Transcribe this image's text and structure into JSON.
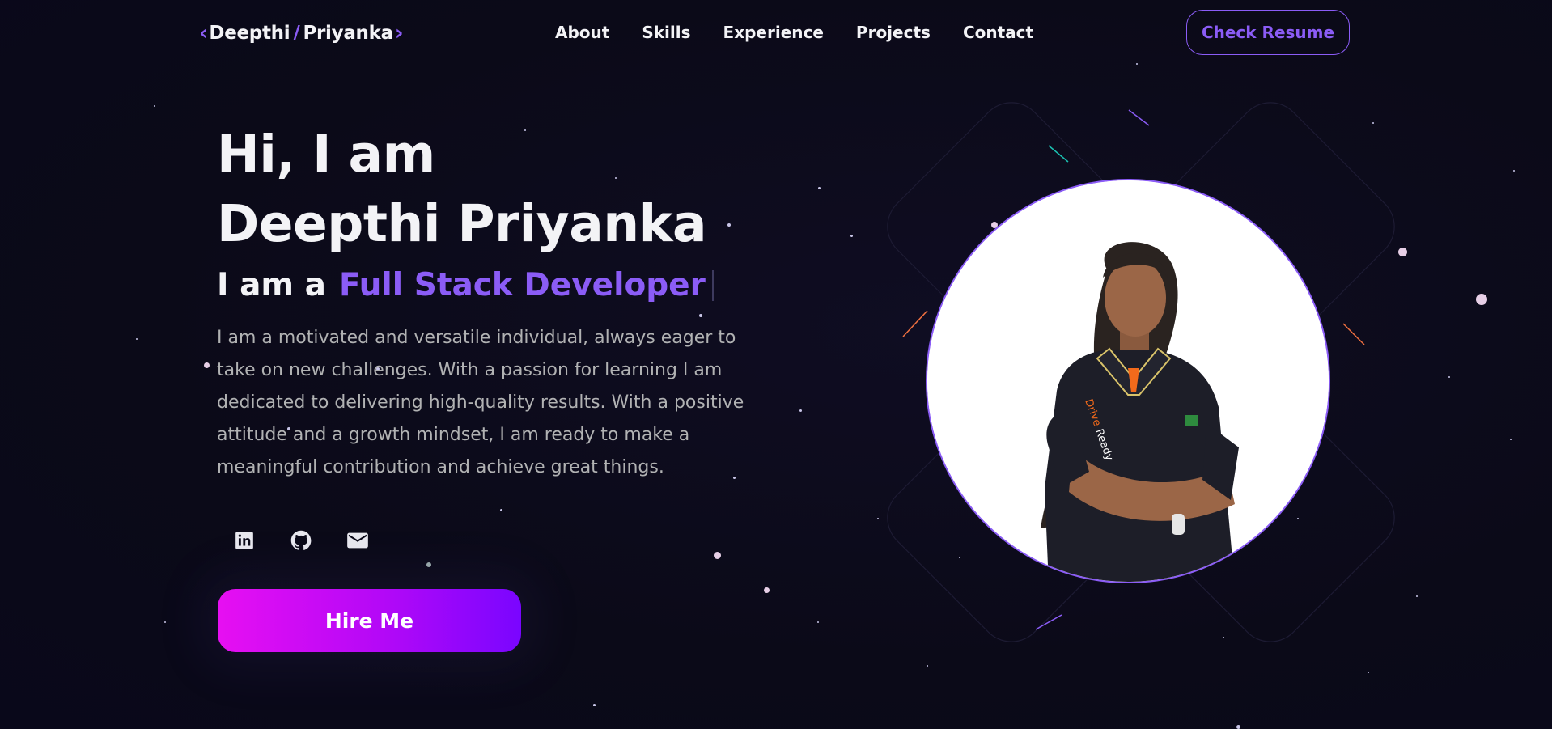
{
  "nav": {
    "logo": {
      "left": "Deepthi",
      "slash": "/",
      "right": "Priyanka"
    },
    "links": [
      "About",
      "Skills",
      "Experience",
      "Projects",
      "Contact"
    ],
    "resume_label": "Check Resume"
  },
  "hero": {
    "greeting_line1": "Hi, I am",
    "greeting_line2": "Deepthi Priyanka",
    "role_prefix": "I am a",
    "role_accent": "Full Stack Developer",
    "description": "I am a motivated and versatile individual, always eager to take on new challenges. With a passion for learning I am dedicated to delivering high-quality results. With a positive attitude and a growth mindset, I am ready to make a meaningful contribution and achieve great things.",
    "socials": [
      "linkedin-icon",
      "github-icon",
      "mail-icon"
    ],
    "hire_label": "Hire Me"
  },
  "profile_image": {
    "alt": "profile-photo"
  },
  "colors": {
    "background": "#0b0a18",
    "accent": "#8b5cf6",
    "button_gradient_start": "#e70ff2",
    "button_gradient_end": "#7a05ff",
    "text_primary": "#f3f3f6",
    "text_secondary": "#b1b2b3"
  }
}
